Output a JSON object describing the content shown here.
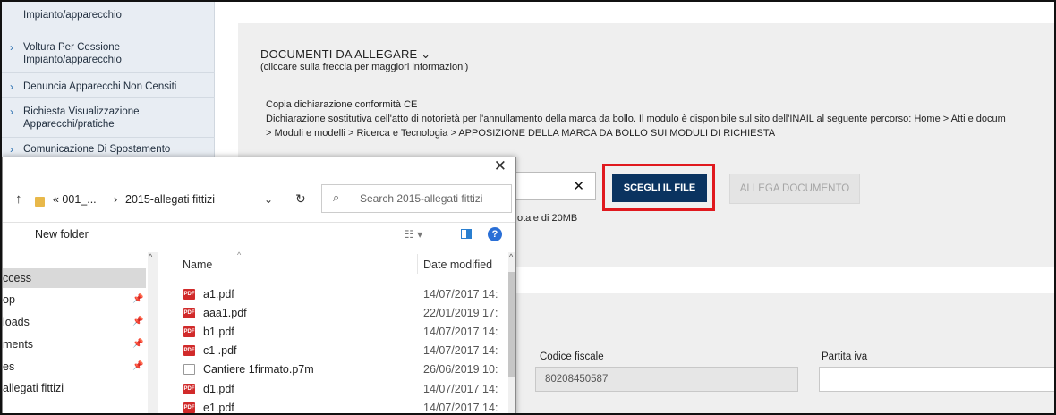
{
  "sidebar": {
    "items": [
      {
        "lines": [
          "Impianto/apparecchio"
        ],
        "chevron": false
      },
      {
        "lines": [
          "Voltura Per Cessione",
          "Impianto/apparecchio"
        ],
        "chevron": true
      },
      {
        "lines": [
          "Denuncia Apparecchi Non Censiti"
        ],
        "chevron": true
      },
      {
        "lines": [
          "Richiesta Visualizzazione",
          "Apparecchi/pratiche"
        ],
        "chevron": true
      },
      {
        "lines": [
          "Comunicazione Di Spostamento"
        ],
        "chevron": true
      }
    ]
  },
  "documents": {
    "title": "DOCUMENTI DA ALLEGARE ⌄",
    "subtitle": "(cliccare sulla freccia per maggiori informazioni)",
    "line1": "Copia dichiarazione conformità CE",
    "line2": "Dichiarazione sostitutiva dell'atto di notorietà per l'annullamento della marca da bollo. Il modulo è disponibile sul sito dell'INAIL al seguente percorso: Home > Atti e docum",
    "line3": "> Moduli e modelli > Ricerca e Tecnologia > APPOSIZIONE DELLA MARCA DA BOLLO SUI MODULI DI RICHIESTA",
    "clear_symbol": "✕",
    "choose_file_label": "SCEGLI IL FILE",
    "attach_label": "ALLEGA DOCUMENTO",
    "size_note": "otale di 20MB"
  },
  "company": {
    "codice_fiscale_label": "Codice fiscale",
    "codice_fiscale_value": "80208450587",
    "partita_iva_label": "Partita iva",
    "partita_iva_value": ""
  },
  "dialog": {
    "close_symbol": "✕",
    "up_arrow": "↑",
    "breadcrumb_root": "«  001_...",
    "breadcrumb_sep": "›",
    "breadcrumb_current": "2015-allegati fittizi",
    "search_placeholder": "Search 2015-allegati fittizi",
    "new_folder_label": "New folder",
    "help_symbol": "?",
    "nav_items": [
      {
        "label": "ccess",
        "pinned": false,
        "selected": true
      },
      {
        "label": "op",
        "pinned": true,
        "selected": false
      },
      {
        "label": "loads",
        "pinned": true,
        "selected": false
      },
      {
        "label": "ments",
        "pinned": true,
        "selected": false
      },
      {
        "label": "es",
        "pinned": true,
        "selected": false
      },
      {
        "label": "allegati fittizi",
        "pinned": false,
        "selected": false
      }
    ],
    "columns": {
      "name": "Name",
      "date": "Date modified"
    },
    "files": [
      {
        "name": "a1.pdf",
        "date": "14/07/2017 14:",
        "type": "pdf"
      },
      {
        "name": "aaa1.pdf",
        "date": "22/01/2019 17:",
        "type": "pdf"
      },
      {
        "name": "b1.pdf",
        "date": "14/07/2017 14:",
        "type": "pdf"
      },
      {
        "name": "c1 .pdf",
        "date": "14/07/2017 14:",
        "type": "pdf"
      },
      {
        "name": "Cantiere 1firmato.p7m",
        "date": "26/06/2019 10:",
        "type": "file"
      },
      {
        "name": "d1.pdf",
        "date": "14/07/2017 14:",
        "type": "pdf"
      },
      {
        "name": "e1.pdf",
        "date": "14/07/2017 14:",
        "type": "pdf"
      }
    ]
  },
  "colors": {
    "primary_button": "#0a3360",
    "highlight": "#e0191e",
    "sidebar_bg": "#e8edf3",
    "panel_bg": "#efefef"
  }
}
